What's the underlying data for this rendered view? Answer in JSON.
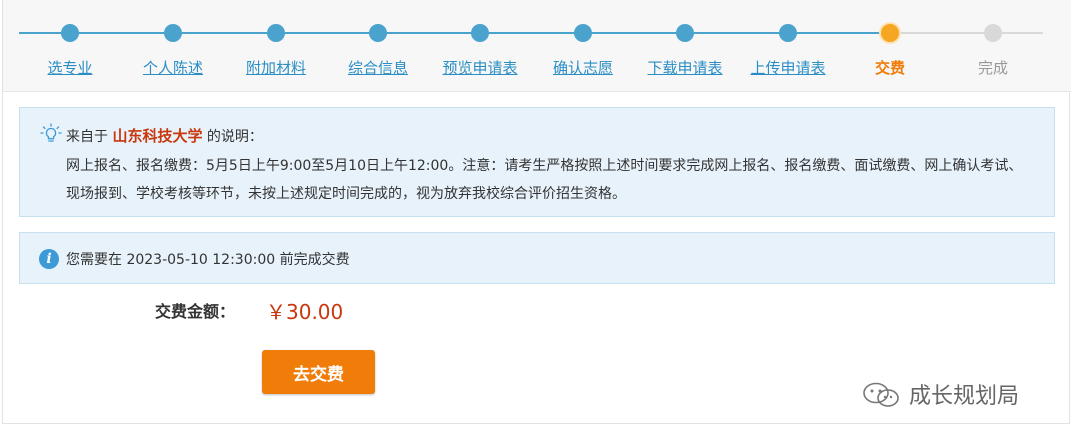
{
  "colors": {
    "done": "#4aa3cc",
    "current_dot": "#f5a623",
    "current_label": "#f07d0a",
    "todo": "#d9d9d9",
    "accent_red": "#c8370d",
    "button": "#f07d0a",
    "info_icon": "#3c9ad6"
  },
  "stepper": {
    "steps": [
      {
        "label": "选专业",
        "state": "done"
      },
      {
        "label": "个人陈述",
        "state": "done"
      },
      {
        "label": "附加材料",
        "state": "done"
      },
      {
        "label": "综合信息",
        "state": "done"
      },
      {
        "label": "预览申请表",
        "state": "done"
      },
      {
        "label": "确认志愿",
        "state": "done"
      },
      {
        "label": "下载申请表",
        "state": "done"
      },
      {
        "label": "上传申请表",
        "state": "done"
      },
      {
        "label": "交费",
        "state": "current"
      },
      {
        "label": "完成",
        "state": "todo"
      }
    ]
  },
  "notice": {
    "icon": "lightbulb-icon",
    "prefix": "来自于",
    "school": "山东科技大学",
    "suffix": "的说明：",
    "body": "网上报名、报名缴费：5月5日上午9:00至5月10日上午12:00。注意：请考生严格按照上述时间要求完成网上报名、报名缴费、面试缴费、网上确认考试、现场报到、学校考核等环节，未按上述规定时间完成的，视为放弃我校综合评价招生资格。"
  },
  "deadline": {
    "icon": "info-icon",
    "text": "您需要在 2023-05-10 12:30:00 前完成交费"
  },
  "payment": {
    "label": "交费金额：",
    "amount": "￥30.00",
    "button": "去交费"
  },
  "watermark": {
    "icon": "wechat-icon",
    "text": "成长规划局"
  }
}
